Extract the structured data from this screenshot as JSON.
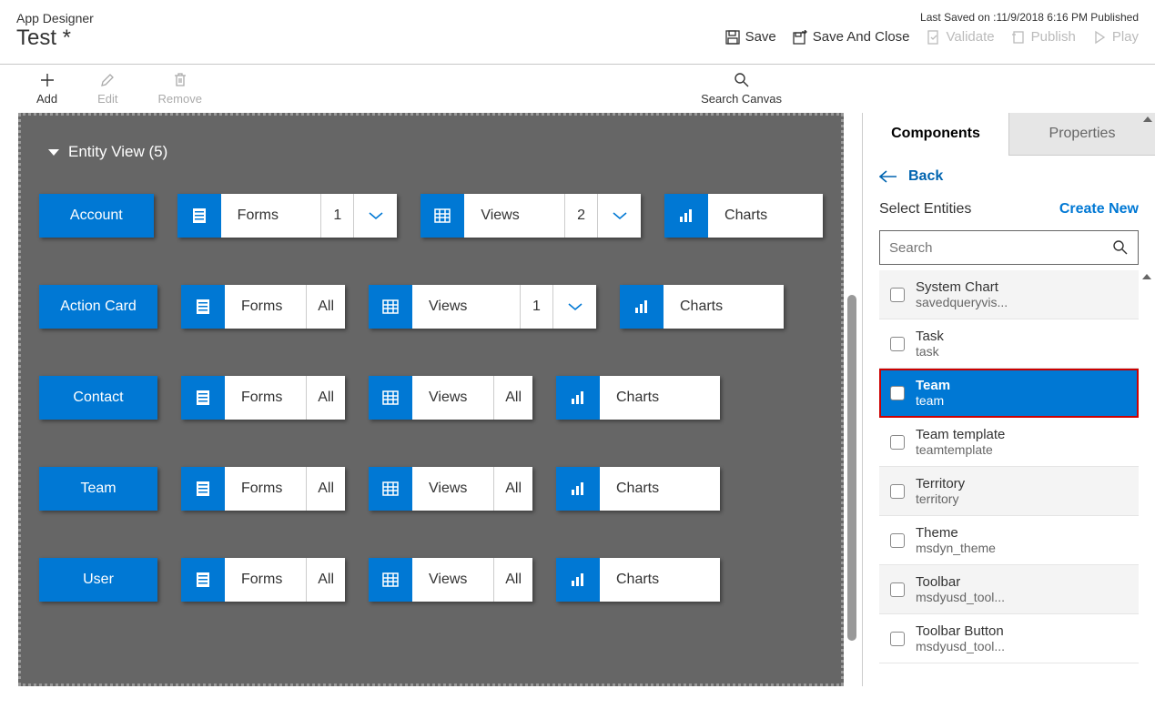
{
  "header": {
    "subtitle": "App Designer",
    "title": "Test *",
    "last_saved": "Last Saved on :11/9/2018 6:16 PM Published",
    "actions": {
      "save": "Save",
      "save_close": "Save And Close",
      "validate": "Validate",
      "publish": "Publish",
      "play": "Play"
    }
  },
  "toolbar": {
    "add": "Add",
    "edit": "Edit",
    "remove": "Remove",
    "search_canvas": "Search Canvas"
  },
  "canvas": {
    "entity_view_label": "Entity View (5)",
    "rows": [
      {
        "name": "Account",
        "forms": {
          "label": "Forms",
          "count": "1",
          "chev": true
        },
        "views": {
          "label": "Views",
          "count": "2",
          "chev": true
        },
        "charts": {
          "label": "Charts"
        }
      },
      {
        "name": "Action Card",
        "forms": {
          "label": "Forms",
          "count": "All"
        },
        "views": {
          "label": "Views",
          "count": "1",
          "chev": true
        },
        "charts": {
          "label": "Charts"
        }
      },
      {
        "name": "Contact",
        "forms": {
          "label": "Forms",
          "count": "All"
        },
        "views": {
          "label": "Views",
          "count": "All"
        },
        "charts": {
          "label": "Charts"
        }
      },
      {
        "name": "Team",
        "forms": {
          "label": "Forms",
          "count": "All"
        },
        "views": {
          "label": "Views",
          "count": "All"
        },
        "charts": {
          "label": "Charts"
        }
      },
      {
        "name": "User",
        "forms": {
          "label": "Forms",
          "count": "All"
        },
        "views": {
          "label": "Views",
          "count": "All"
        },
        "charts": {
          "label": "Charts"
        }
      }
    ]
  },
  "panel": {
    "tabs": {
      "components": "Components",
      "properties": "Properties"
    },
    "back": "Back",
    "select_entities": "Select Entities",
    "create_new": "Create New",
    "search_placeholder": "Search",
    "entities": [
      {
        "name": "System Chart",
        "sub": "savedqueryvis...",
        "checked": false,
        "selected": false,
        "alt": true
      },
      {
        "name": "Task",
        "sub": "task",
        "checked": false,
        "selected": false,
        "alt": false
      },
      {
        "name": "Team",
        "sub": "team",
        "checked": true,
        "selected": true,
        "alt": false,
        "highlighted": true
      },
      {
        "name": "Team template",
        "sub": "teamtemplate",
        "checked": false,
        "selected": false,
        "alt": false
      },
      {
        "name": "Territory",
        "sub": "territory",
        "checked": false,
        "selected": false,
        "alt": true
      },
      {
        "name": "Theme",
        "sub": "msdyn_theme",
        "checked": false,
        "selected": false,
        "alt": false
      },
      {
        "name": "Toolbar",
        "sub": "msdyusd_tool...",
        "checked": false,
        "selected": false,
        "alt": true
      },
      {
        "name": "Toolbar Button",
        "sub": "msdyusd_tool...",
        "checked": false,
        "selected": false,
        "alt": false
      }
    ]
  }
}
